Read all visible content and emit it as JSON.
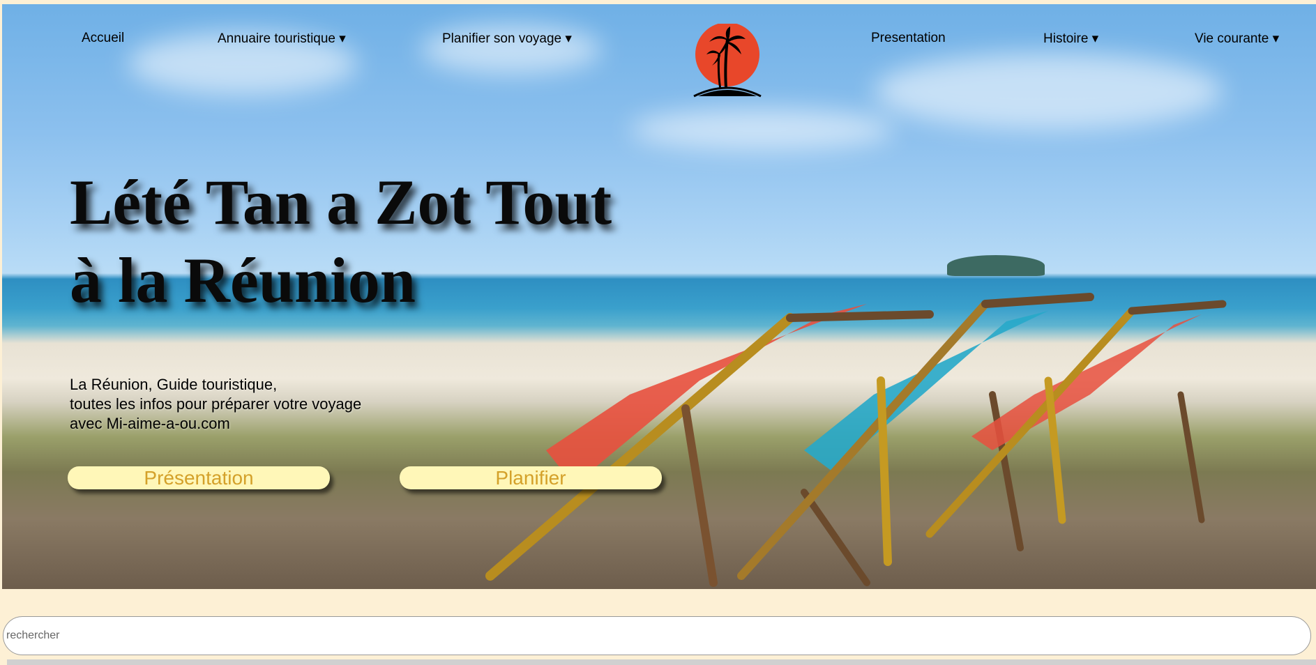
{
  "nav": {
    "items": [
      {
        "label": "Accueil"
      },
      {
        "label": "Annuaire touristique ▾"
      },
      {
        "label": "Planifier son voyage ▾"
      },
      {
        "label": "Presentation"
      },
      {
        "label": "Histoire ▾"
      },
      {
        "label": "Vie courante ▾"
      }
    ],
    "logo_icon": "palm-sunset-icon"
  },
  "hero": {
    "headline_line1": "Lété Tan a Zot Tout",
    "headline_line2": "à la Réunion",
    "subtitle_line1": "La Réunion, Guide touristique,",
    "subtitle_line2": "toutes les infos pour préparer votre voyage",
    "subtitle_line3": "avec Mi-aime-a-ou.com",
    "buttons": [
      {
        "label": "Présentation"
      },
      {
        "label": "Planifier"
      }
    ]
  },
  "search": {
    "placeholder": "rechercher"
  },
  "colors": {
    "page_background": "#fdf0d5",
    "button_background": "#fff7b8",
    "button_text": "#d4a12a",
    "logo_sun": "#e8472a"
  }
}
